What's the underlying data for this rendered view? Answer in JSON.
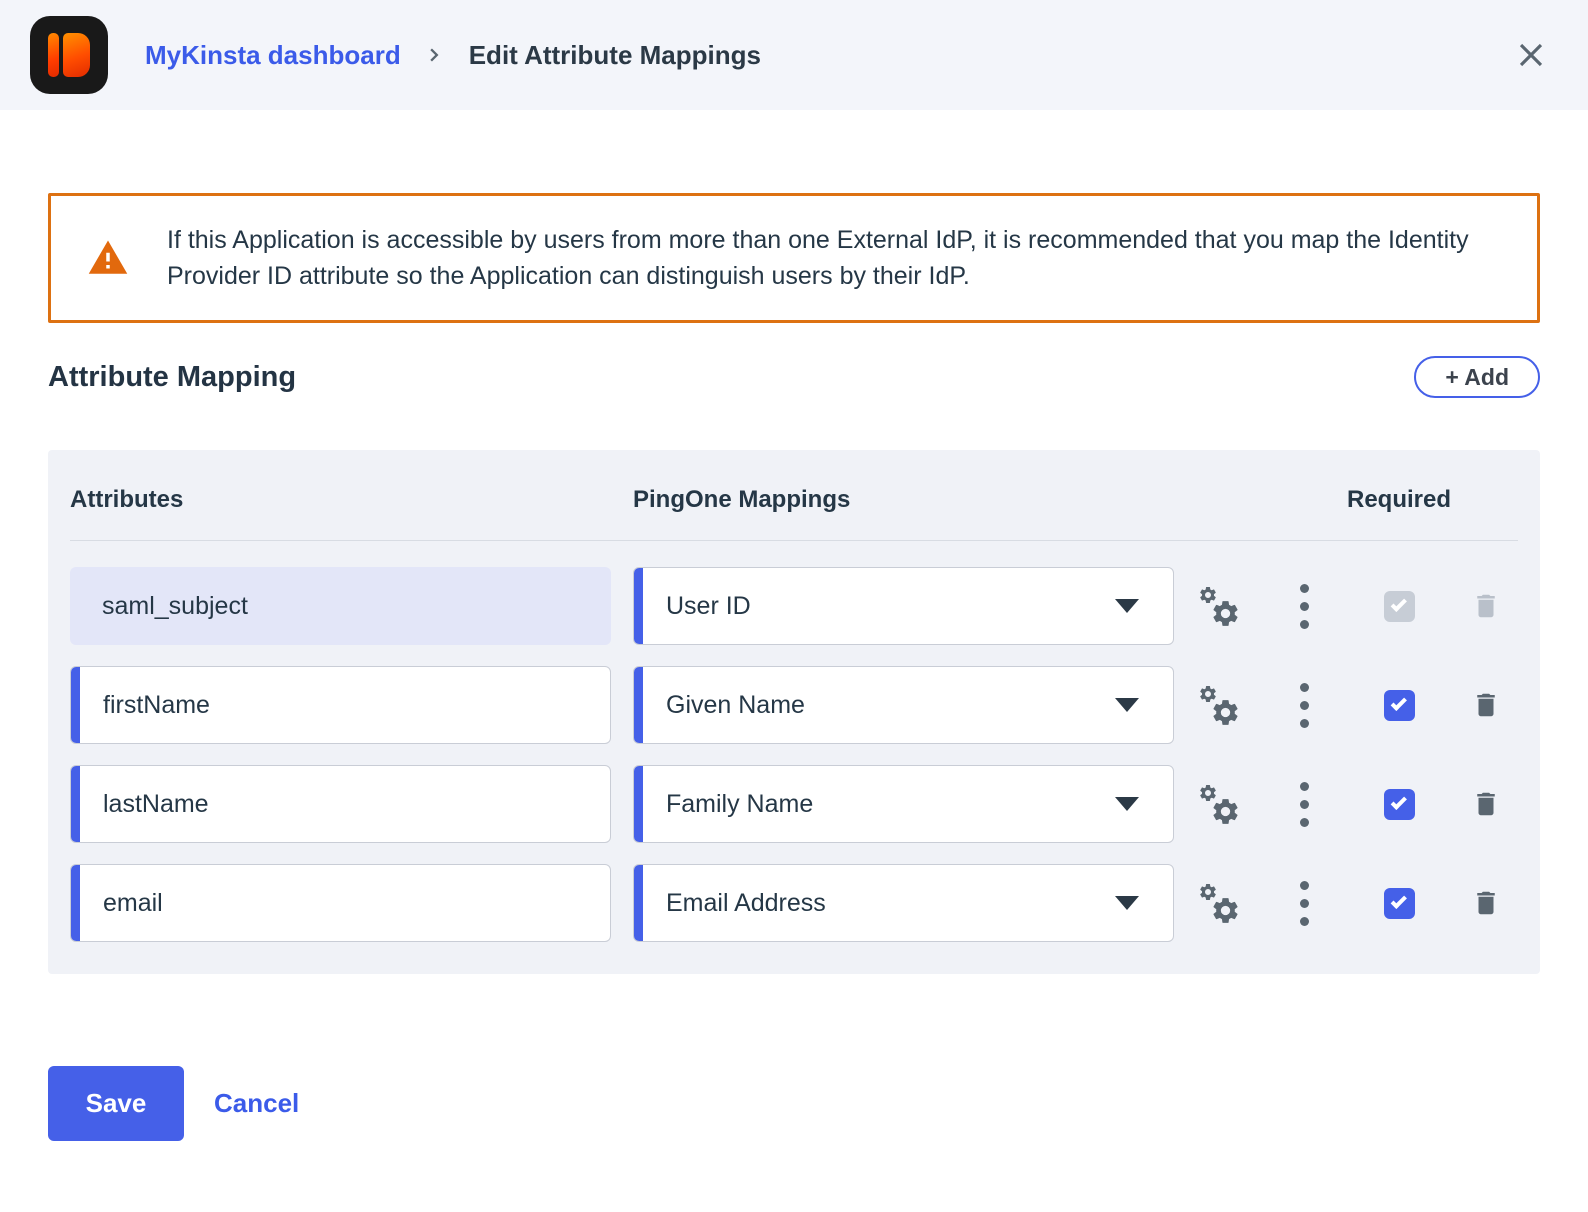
{
  "header": {
    "breadcrumb_link": "MyKinsta dashboard",
    "title": "Edit Attribute Mappings"
  },
  "warning": {
    "text": "If this Application is accessible by users from more than one External IdP, it is recommended that you map the Identity Provider ID attribute so the Application can distinguish users by their IdP."
  },
  "section": {
    "title": "Attribute Mapping",
    "add_button_label": "+ Add"
  },
  "table": {
    "headers": {
      "attributes": "Attributes",
      "mappings": "PingOne Mappings",
      "required": "Required"
    },
    "rows": [
      {
        "attribute": "saml_subject",
        "mapping": "User ID",
        "required": true,
        "locked": true
      },
      {
        "attribute": "firstName",
        "mapping": "Given Name",
        "required": true,
        "locked": false
      },
      {
        "attribute": "lastName",
        "mapping": "Family Name",
        "required": true,
        "locked": false
      },
      {
        "attribute": "email",
        "mapping": "Email Address",
        "required": true,
        "locked": false
      }
    ]
  },
  "actions": {
    "save_label": "Save",
    "cancel_label": "Cancel"
  },
  "colors": {
    "accent_blue": "#4560E8",
    "link_blue": "#3B5BE9",
    "warning_orange": "#DD7112",
    "text_navy": "#253746",
    "icon_gray": "#5A6670"
  }
}
